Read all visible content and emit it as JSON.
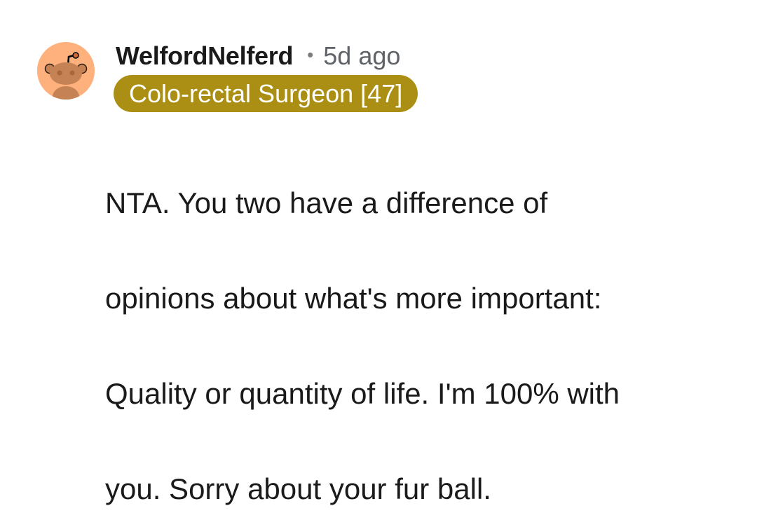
{
  "comment": {
    "author": "WelfordNelferd",
    "separator": "•",
    "timestamp": "5d ago",
    "flair": {
      "text": "Colo-rectal Surgeon [47]",
      "background_color": "#ab8f14",
      "text_color": "#ffffff"
    },
    "avatar": {
      "icon": "snoo-avatar-icon",
      "background_color": "#ffb17d"
    },
    "body_lines": [
      "NTA. You two have a difference of",
      "opinions about what's more important:",
      "Quality or quantity of life. I'm 100% with",
      "you. Sorry about your fur ball."
    ]
  }
}
